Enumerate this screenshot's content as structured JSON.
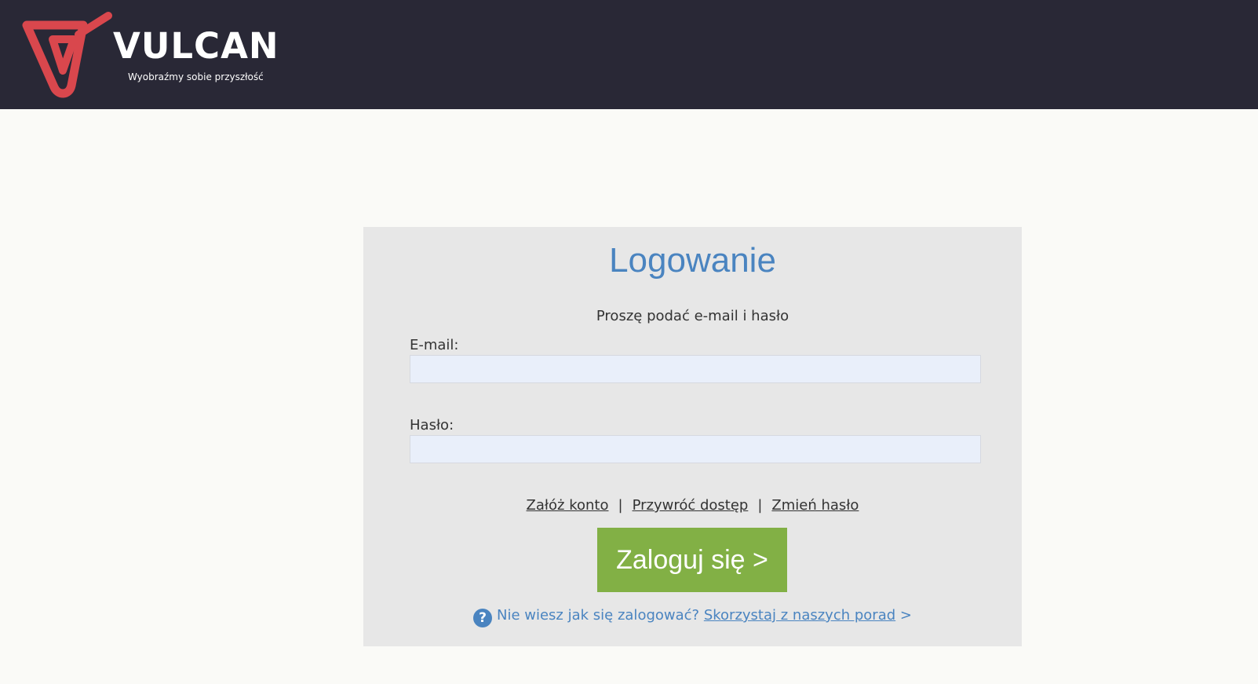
{
  "header": {
    "logo_text": "VULCAN",
    "tagline": "Wyobraźmy sobie przyszłość",
    "background_color": "#292836",
    "logo_color": "#d9474d"
  },
  "login": {
    "title": "Logowanie",
    "subtitle": "Proszę podać e-mail i hasło",
    "email_label": "E-mail:",
    "email_value": "",
    "password_label": "Hasło:",
    "password_value": "",
    "links": {
      "create_account": "Załóż konto",
      "restore_access": "Przywróć dostęp",
      "change_password": "Zmień hasło",
      "separator": "|"
    },
    "submit_label": "Zaloguj się >",
    "help": {
      "icon": "question-circle-icon",
      "question": "Nie wiesz jak się zalogować?",
      "link_text": "Skorzystaj z naszych porad",
      "arrow": ">"
    }
  },
  "colors": {
    "accent_blue": "#4a84c0",
    "button_green": "#82b045",
    "panel_bg": "#e7e7e7",
    "input_bg": "#e9effa"
  }
}
